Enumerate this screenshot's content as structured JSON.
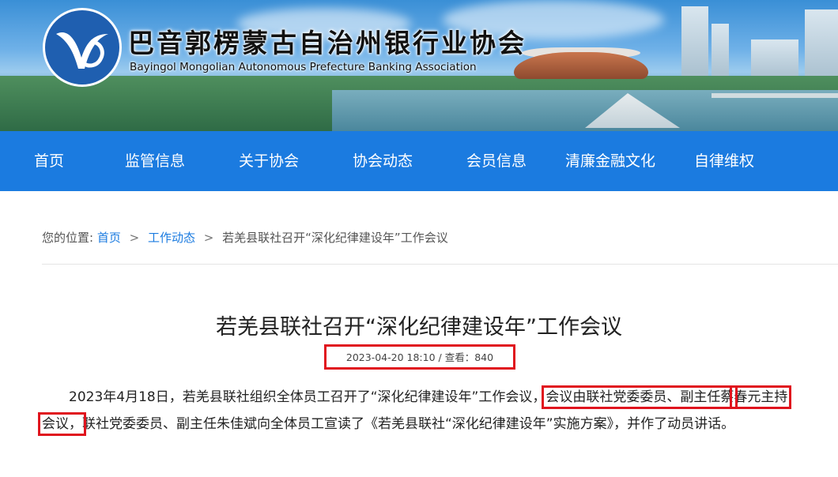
{
  "site": {
    "title_cn": "巴音郭楞蒙古自治州银行业协会",
    "title_en": "Bayingol Mongolian Autonomous Prefecture Banking Association"
  },
  "nav": {
    "items": [
      "首页",
      "监管信息",
      "关于协会",
      "协会动态",
      "会员信息",
      "清廉金融文化",
      "自律维权"
    ]
  },
  "breadcrumb": {
    "prefix": "您的位置:",
    "home": "首页",
    "sep": ">",
    "section": "工作动态",
    "current": "若羌县联社召开“深化纪律建设年”工作会议"
  },
  "article": {
    "title": "若羌县联社召开“深化纪律建设年”工作会议",
    "meta": "2023-04-20 18:10 / 查看：840",
    "p1_a": "2023年4月18日，若羌县联社组织全体员工召开了“深化纪律建设年”工作会议，",
    "p1_hl1": "会议由联社党委委员、副主任蔡",
    "p1_hl2": "春元主持会议，",
    "p1_b": "联社党委委员、副主任朱佳斌向全体员工宣读了《若羌县联社“深化纪律建设年”实施方案》，并作了动员讲话。"
  },
  "colors": {
    "nav_bg": "#1b7be0",
    "link": "#1b7be0",
    "highlight_box": "#e0141e",
    "logo_bg": "#1f5fb0"
  },
  "icons": [
    "association-logo-icon"
  ]
}
